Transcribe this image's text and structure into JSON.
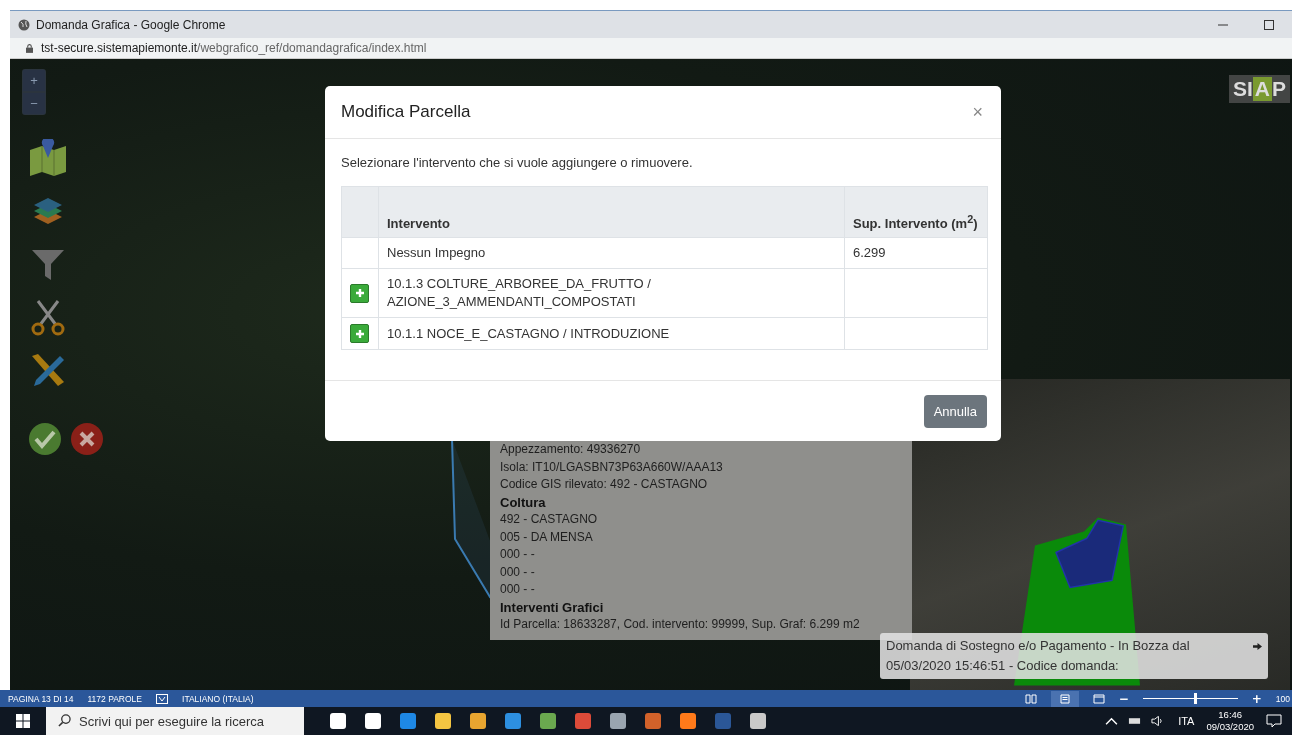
{
  "window": {
    "title": "Domanda Grafica - Google Chrome",
    "url_host": "tst-secure.sistemapiemonte.it",
    "url_path": "/webgrafico_ref/domandagrafica/index.html"
  },
  "map": {
    "zoom_in": "+",
    "zoom_out": "−",
    "logo": [
      {
        "text": "SI",
        "highlight": false
      },
      {
        "text": "A",
        "highlight": true
      },
      {
        "text": "P",
        "highlight": false
      }
    ],
    "tools": [
      {
        "kind": "map"
      },
      {
        "kind": "layers"
      },
      {
        "kind": "filter"
      },
      {
        "kind": "scissors"
      },
      {
        "kind": "draw"
      }
    ]
  },
  "modal": {
    "title": "Modifica Parcella",
    "close": "×",
    "instruction": "Selezionare l'intervento che si vuole aggiungere o rimuovere.",
    "columns": [
      "Intervento",
      "Sup. Intervento (m$^{2}$)"
    ],
    "rows": [
      {
        "addable": false,
        "intervento": "Nessun Impegno",
        "sup": "6.299"
      },
      {
        "addable": true,
        "intervento": "10.1.3 COLTURE_ARBOREE_DA_FRUTTO / AZIONE_3_AMMENDANTI_COMPOSTATI",
        "sup": ""
      },
      {
        "addable": true,
        "intervento": "10.1.1 NOCE_E_CASTAGNO / INTRODUZIONE",
        "sup": ""
      }
    ],
    "cancel": "Annulla"
  },
  "info_panel": [
    {
      "kind": "line",
      "text": "Appezzamento: 49336270"
    },
    {
      "kind": "line",
      "text": "Isola: IT10/LGASBN73P63A660W/AAA13"
    },
    {
      "kind": "line",
      "text": "Codice GIS rilevato: 492 - CASTAGNO"
    },
    {
      "kind": "heading",
      "text": "Coltura"
    },
    {
      "kind": "line",
      "text": "492 - CASTAGNO"
    },
    {
      "kind": "line",
      "text": "005 - DA MENSA"
    },
    {
      "kind": "line",
      "text": "000 - -"
    },
    {
      "kind": "line",
      "text": "000 - -"
    },
    {
      "kind": "line",
      "text": "000 - -"
    },
    {
      "kind": "heading",
      "text": "Interventi Grafici"
    },
    {
      "kind": "line",
      "text": "Id Parcella: 18633287, Cod. intervento: 99999, Sup. Graf: 6.299 m2"
    }
  ],
  "notice": "Domanda di Sostegno e/o Pagamento - In Bozza dal 05/03/2020 15:46:51 - Codice domanda:",
  "word_status": {
    "page": "PAGINA 13 DI 14",
    "words": "1172 PAROLE",
    "language": "ITALIANO (ITALIA)",
    "zoom_minus": "−",
    "zoom_plus": "+",
    "zoom": "100",
    "level": 0.55
  },
  "taskbar": {
    "search_placeholder": "Scrivi qui per eseguire la ricerca",
    "language": "ITA",
    "time": "16:46",
    "date": "09/03/2020",
    "apps": [
      {
        "color": "#ffffff"
      },
      {
        "color": "#ffffff"
      },
      {
        "color": "#1e88e5"
      },
      {
        "color": "#f4c542"
      },
      {
        "color": "#e8a530"
      },
      {
        "color": "#2d8fe0"
      },
      {
        "color": "#6aa84f"
      },
      {
        "color": "#dd4b39"
      },
      {
        "color": "#9aa5b0"
      },
      {
        "color": "#d2622a"
      },
      {
        "color": "#ff7a1a"
      },
      {
        "color": "#2b5797"
      },
      {
        "color": "#c9c9c9"
      }
    ]
  }
}
